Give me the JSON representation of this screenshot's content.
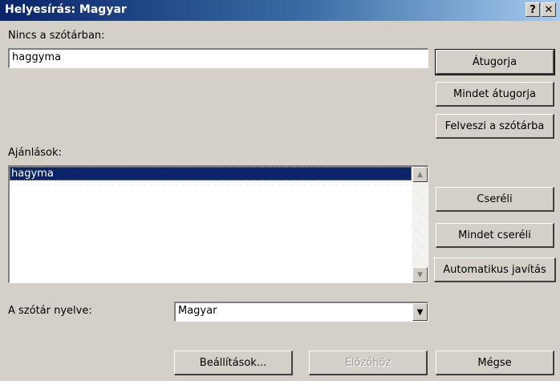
{
  "window": {
    "title": "Helyesírás: Magyar",
    "help_label": "?",
    "close_label": "✕"
  },
  "not_in_dictionary": {
    "label": "Nincs a szótárban:",
    "value": "haggyma"
  },
  "suggestions": {
    "label": "Ajánlások:",
    "items": [
      "hagyma"
    ],
    "selected": "hagyma"
  },
  "language": {
    "label": "A szótár nyelve:",
    "value": "Magyar"
  },
  "buttons": {
    "ignore": "Átugorja",
    "ignore_all": "Mindet átugorja",
    "add": "Felveszi a szótárba",
    "change": "Cseréli",
    "change_all": "Mindet cseréli",
    "autocorrect": "Automatikus javítás",
    "options": "Beállítások...",
    "undo": "Előzőhöz",
    "cancel": "Mégse"
  },
  "icons": {
    "scroll_up": "scroll-up-arrow-icon",
    "scroll_down": "scroll-down-arrow-icon",
    "dropdown": "dropdown-arrow-icon"
  }
}
